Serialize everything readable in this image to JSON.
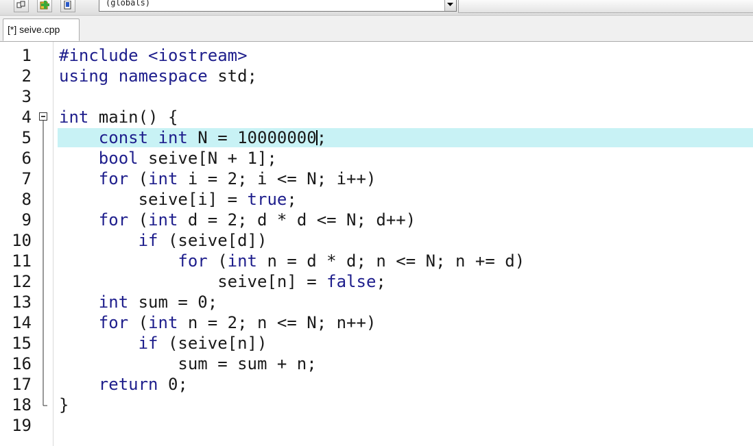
{
  "toolbar": {
    "buttons": [
      {
        "icon": "class-view-icon"
      },
      {
        "icon": "add-item-icon"
      },
      {
        "icon": "bookmark-icon"
      }
    ],
    "scope_value": "(globals)"
  },
  "tab": {
    "label": "[*] seive.cpp"
  },
  "editor": {
    "current_line": 5,
    "highlight_color": "#c8f2f5",
    "keyword_color": "#1e1e8c",
    "lines": [
      {
        "num": "1",
        "indent": "",
        "tokens": [
          {
            "t": "#include <iostream>",
            "k": "pp"
          }
        ]
      },
      {
        "num": "2",
        "indent": "",
        "tokens": [
          {
            "t": "using namespace",
            "k": "kw"
          },
          {
            "t": " std;",
            "k": ""
          }
        ]
      },
      {
        "num": "3",
        "indent": "",
        "tokens": []
      },
      {
        "num": "4",
        "indent": "",
        "tokens": [
          {
            "t": "int",
            "k": "kw"
          },
          {
            "t": " main() {",
            "k": ""
          }
        ]
      },
      {
        "num": "5",
        "indent": "    ",
        "tokens": [
          {
            "t": "const int",
            "k": "kw"
          },
          {
            "t": " N = 10000000",
            "k": ""
          },
          {
            "t": "|",
            "k": "caret"
          },
          {
            "t": ";",
            "k": ""
          }
        ]
      },
      {
        "num": "6",
        "indent": "    ",
        "tokens": [
          {
            "t": "bool",
            "k": "kw"
          },
          {
            "t": " seive[N + 1];",
            "k": ""
          }
        ]
      },
      {
        "num": "7",
        "indent": "    ",
        "tokens": [
          {
            "t": "for",
            "k": "kw"
          },
          {
            "t": " (",
            "k": ""
          },
          {
            "t": "int",
            "k": "kw"
          },
          {
            "t": " i = 2; i <= N; i++)",
            "k": ""
          }
        ]
      },
      {
        "num": "8",
        "indent": "        ",
        "tokens": [
          {
            "t": "seive[i] = ",
            "k": ""
          },
          {
            "t": "true",
            "k": "kw"
          },
          {
            "t": ";",
            "k": ""
          }
        ]
      },
      {
        "num": "9",
        "indent": "    ",
        "tokens": [
          {
            "t": "for",
            "k": "kw"
          },
          {
            "t": " (",
            "k": ""
          },
          {
            "t": "int",
            "k": "kw"
          },
          {
            "t": " d = 2; d * d <= N; d++)",
            "k": ""
          }
        ]
      },
      {
        "num": "10",
        "indent": "        ",
        "tokens": [
          {
            "t": "if",
            "k": "kw"
          },
          {
            "t": " (seive[d])",
            "k": ""
          }
        ]
      },
      {
        "num": "11",
        "indent": "            ",
        "tokens": [
          {
            "t": "for",
            "k": "kw"
          },
          {
            "t": " (",
            "k": ""
          },
          {
            "t": "int",
            "k": "kw"
          },
          {
            "t": " n = d * d; n <= N; n += d)",
            "k": ""
          }
        ]
      },
      {
        "num": "12",
        "indent": "                ",
        "tokens": [
          {
            "t": "seive[n] = ",
            "k": ""
          },
          {
            "t": "false",
            "k": "kw"
          },
          {
            "t": ";",
            "k": ""
          }
        ]
      },
      {
        "num": "13",
        "indent": "    ",
        "tokens": [
          {
            "t": "int",
            "k": "kw"
          },
          {
            "t": " sum = 0;",
            "k": ""
          }
        ]
      },
      {
        "num": "14",
        "indent": "    ",
        "tokens": [
          {
            "t": "for",
            "k": "kw"
          },
          {
            "t": " (",
            "k": ""
          },
          {
            "t": "int",
            "k": "kw"
          },
          {
            "t": " n = 2; n <= N; n++)",
            "k": ""
          }
        ]
      },
      {
        "num": "15",
        "indent": "        ",
        "tokens": [
          {
            "t": "if",
            "k": "kw"
          },
          {
            "t": " (seive[n])",
            "k": ""
          }
        ]
      },
      {
        "num": "16",
        "indent": "            ",
        "tokens": [
          {
            "t": "sum = sum + n;",
            "k": ""
          }
        ]
      },
      {
        "num": "17",
        "indent": "    ",
        "tokens": [
          {
            "t": "return",
            "k": "kw"
          },
          {
            "t": " 0;",
            "k": ""
          }
        ]
      },
      {
        "num": "18",
        "indent": "",
        "tokens": [
          {
            "t": "}",
            "k": ""
          }
        ]
      },
      {
        "num": "19",
        "indent": "",
        "tokens": []
      }
    ]
  }
}
